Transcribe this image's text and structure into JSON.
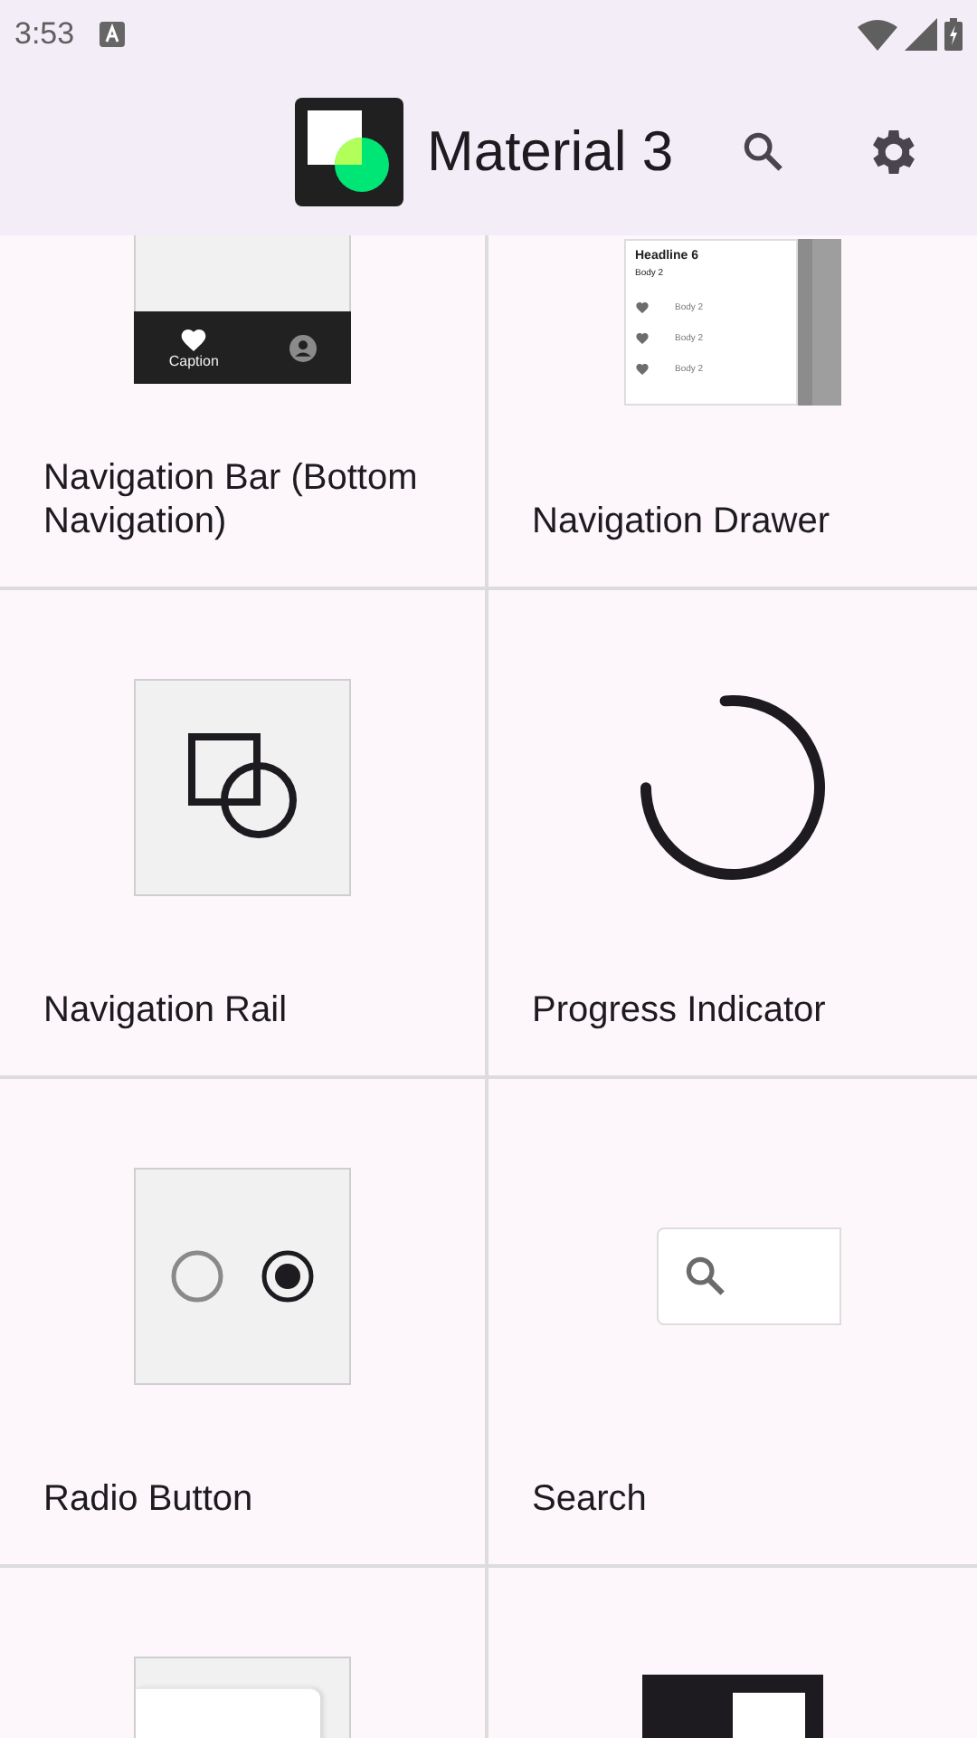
{
  "status_bar": {
    "time": "3:53"
  },
  "app_bar": {
    "title": "Material 3"
  },
  "rows": [
    {
      "components": [
        {
          "kind": "nav_bar",
          "label": "Navigation Bar (Bottom Navigation)",
          "caption": "Caption"
        },
        {
          "kind": "nav_drawer",
          "label": "Navigation Drawer",
          "headline": "Headline 6",
          "subtitle": "Body 2",
          "items": [
            "Body 2",
            "Body 2",
            "Body 2"
          ]
        }
      ]
    },
    {
      "components": [
        {
          "kind": "nav_rail",
          "label": "Navigation Rail"
        },
        {
          "kind": "progress",
          "label": "Progress Indicator"
        }
      ]
    },
    {
      "components": [
        {
          "kind": "radio",
          "label": "Radio Button"
        },
        {
          "kind": "search",
          "label": "Search"
        }
      ]
    },
    {
      "components": [
        {
          "kind": "sheet"
        },
        {
          "kind": "switch_box"
        }
      ]
    }
  ]
}
